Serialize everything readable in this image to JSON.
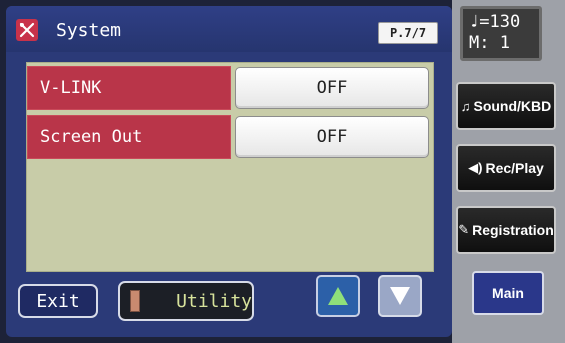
{
  "window": {
    "title": "System",
    "page": "P.7/7"
  },
  "settings": [
    {
      "label": "V-LINK",
      "value": "OFF"
    },
    {
      "label": "Screen Out",
      "value": "OFF"
    }
  ],
  "footer": {
    "exit_label": "Exit",
    "utility_label": "Utility"
  },
  "status": {
    "tempo_glyph": "♩",
    "tempo": "=130",
    "measure": "M:  1"
  },
  "sidebar": {
    "sound_kbd": "Sound/KBD",
    "rec_play": "Rec/Play",
    "registration": "Registration",
    "main": "Main"
  },
  "colors": {
    "title_bar": "#2b3a78",
    "row_label": "#b93549",
    "panel": "#c8cca8",
    "utility_text": "#d7e29b",
    "arrow_up": "#2c60a8",
    "arrow_down": "#9aa7c6"
  },
  "icons": [
    "system-icon",
    "utility-icon",
    "arrow-up-icon",
    "arrow-down-icon",
    "music-note-icon",
    "speaker-icon",
    "registration-icon"
  ]
}
